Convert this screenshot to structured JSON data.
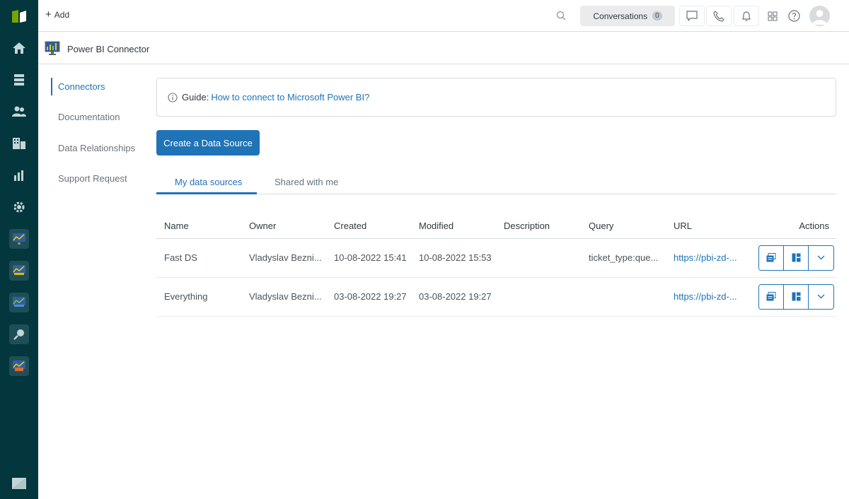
{
  "topbar": {
    "add_label": "Add",
    "conversations_label": "Conversations",
    "conversations_count": "0"
  },
  "app": {
    "title": "Power BI Connector"
  },
  "sidemenu": {
    "items": [
      {
        "label": "Connectors",
        "active": true
      },
      {
        "label": "Documentation",
        "active": false
      },
      {
        "label": "Data Relationships",
        "active": false
      },
      {
        "label": "Support Request",
        "active": false
      }
    ]
  },
  "guide": {
    "prefix": "Guide:",
    "link_text": "How to connect to Microsoft Power BI?"
  },
  "create_button": "Create a Data Source",
  "tabs": [
    {
      "label": "My data sources",
      "active": true
    },
    {
      "label": "Shared with me",
      "active": false
    }
  ],
  "table": {
    "headers": [
      "Name",
      "Owner",
      "Created",
      "Modified",
      "Description",
      "Query",
      "URL",
      "Actions"
    ],
    "rows": [
      {
        "name": "Fast DS",
        "owner": "Vladyslav Bezni...",
        "created": "10-08-2022 15:41",
        "modified": "10-08-2022 15:53",
        "description": "",
        "query": "ticket_type:que...",
        "url": "https://pbi-zd-..."
      },
      {
        "name": "Everything",
        "owner": "Vladyslav Bezni...",
        "created": "03-08-2022 19:27",
        "modified": "03-08-2022 19:27",
        "description": "",
        "query": "",
        "url": "https://pbi-zd-..."
      }
    ]
  },
  "colors": {
    "nav_bg": "#03363d",
    "accent": "#1f73b7",
    "border": "#d8dcde"
  },
  "icons": {
    "nav": [
      "home-icon",
      "views-icon",
      "customers-icon",
      "organizations-icon",
      "reporting-icon",
      "admin-gear-icon"
    ],
    "apps": [
      "app-powerbi-1-icon",
      "app-powerbi-2-icon",
      "app-powerbi-3-icon",
      "app-magnifier-icon",
      "app-powerbi-4-icon"
    ],
    "top": [
      "search-icon",
      "chat-icon",
      "phone-icon",
      "bell-icon",
      "products-grid-icon",
      "help-icon",
      "avatar"
    ],
    "row_actions": [
      "copy-icon",
      "dashboard-icon",
      "chevron-down-icon"
    ]
  }
}
